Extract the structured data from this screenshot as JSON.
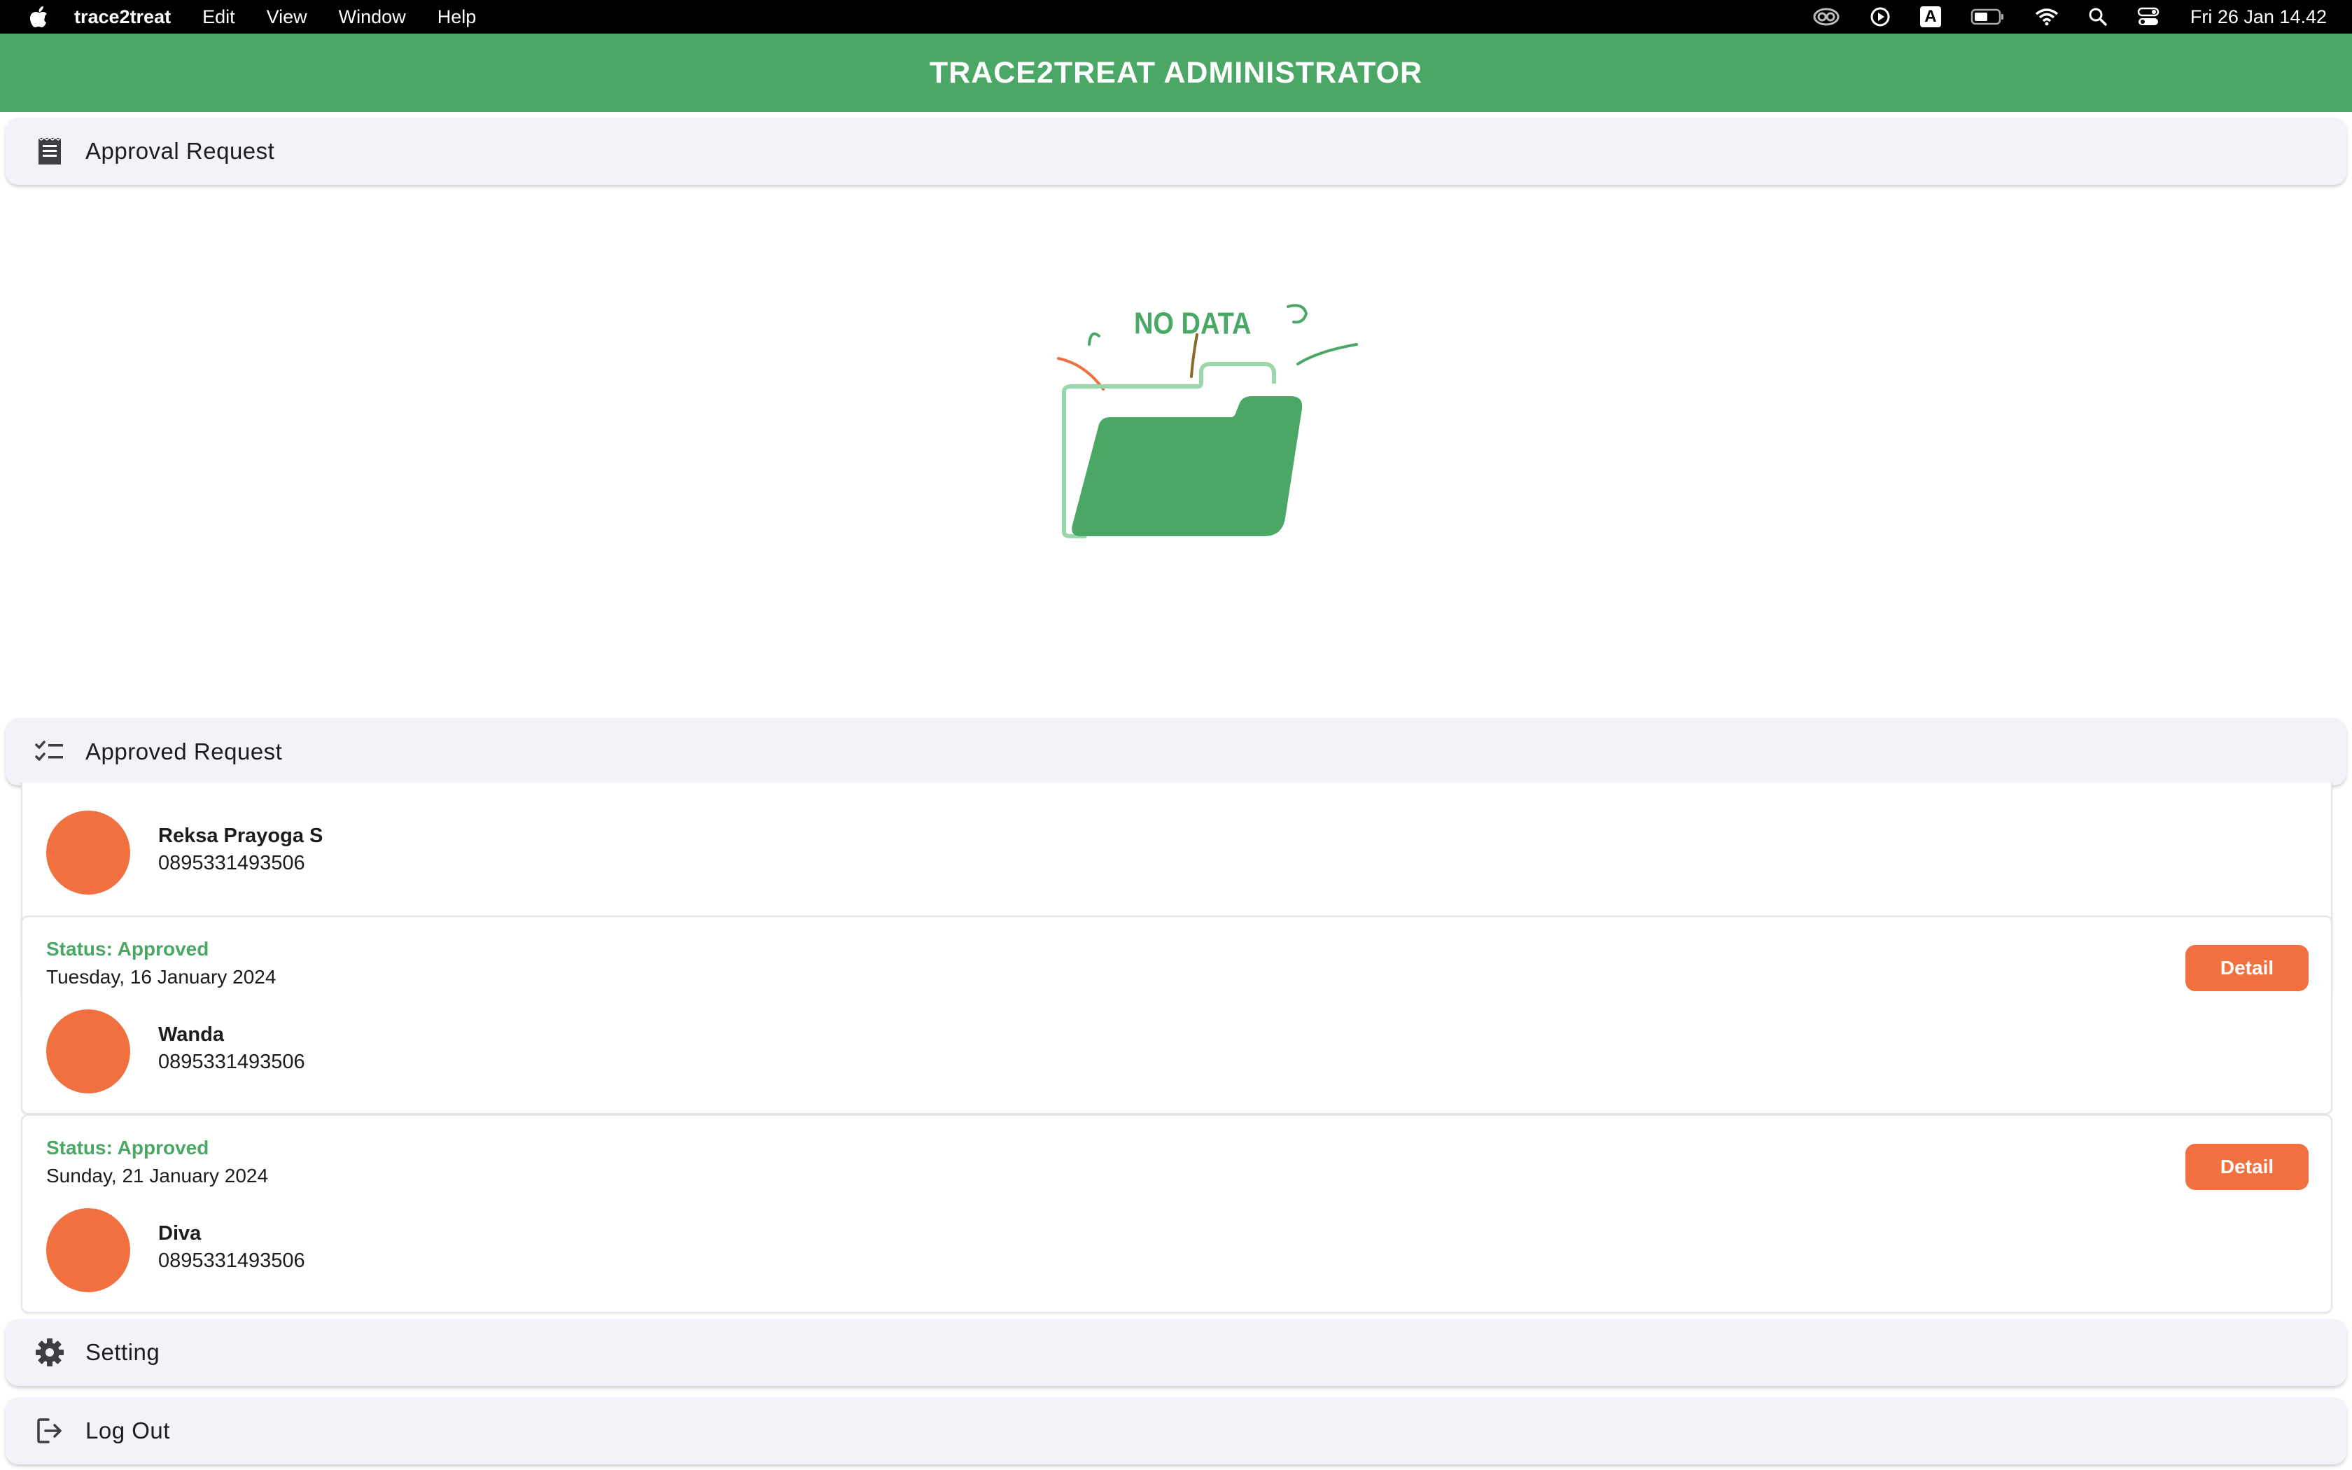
{
  "menubar": {
    "app_name": "trace2treat",
    "items": [
      "Edit",
      "View",
      "Window",
      "Help"
    ],
    "clock": "Fri 26 Jan  14.42",
    "input_indicator": "A"
  },
  "appbar": {
    "title": "TRACE2TREAT ADMINISTRATOR"
  },
  "approval_section": {
    "label": "Approval Request",
    "empty_text": "NO DATA"
  },
  "approved_section": {
    "label": "Approved Request",
    "items": [
      {
        "status": "",
        "date": "",
        "name": "Reksa Prayoga S",
        "phone": "0895331493506",
        "detail_label": ""
      },
      {
        "status": "Status: Approved",
        "date": "Tuesday, 16 January 2024",
        "name": "Wanda",
        "phone": "0895331493506",
        "detail_label": "Detail"
      },
      {
        "status": "Status: Approved",
        "date": "Sunday, 21 January 2024",
        "name": "Diva",
        "phone": "0895331493506",
        "detail_label": "Detail"
      }
    ]
  },
  "setting_section": {
    "label": "Setting"
  },
  "logout_section": {
    "label": "Log Out"
  },
  "colors": {
    "primary_green": "#4ba765",
    "accent_orange": "#f07040",
    "section_bg": "#f5f1f8"
  }
}
